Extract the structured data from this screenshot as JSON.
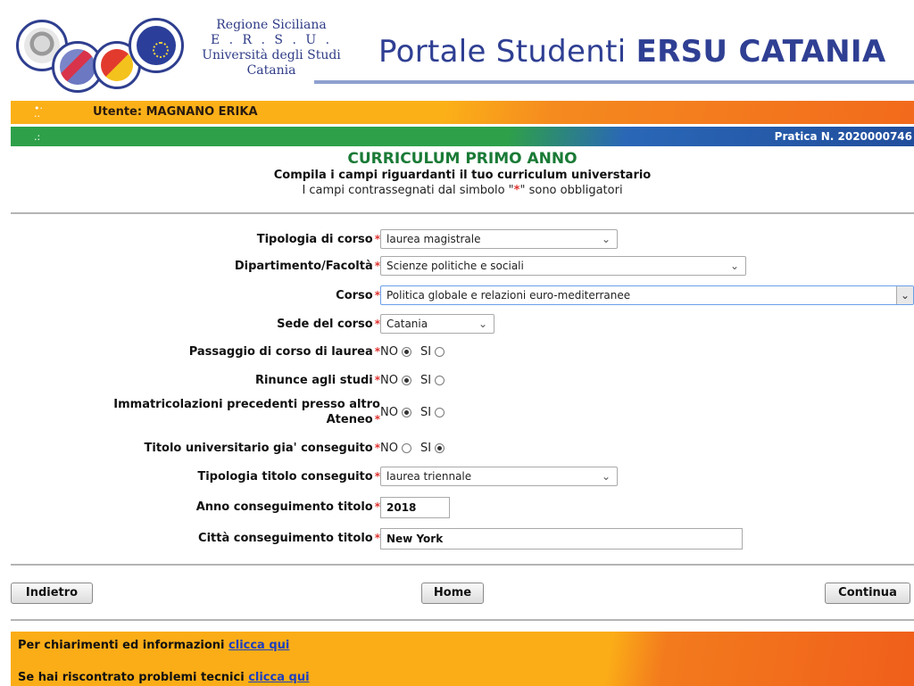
{
  "header": {
    "institution": [
      "Regione Siciliana",
      "E . R . S . U .",
      "Università degli Studi",
      "Catania"
    ],
    "portal_title_prefix": "Portale Studenti",
    "portal_title_bold": "ERSU CATANIA"
  },
  "userbar": {
    "user": "Utente: MAGNANO ERIKA"
  },
  "pracbar": {
    "pratica": "Pratica N. 2020000746"
  },
  "heading": {
    "title": "CURRICULUM PRIMO ANNO",
    "subtitle": "Compila i campi riguardanti il tuo curriculum universtario",
    "note_before": "I campi contrassegnati dal simbolo \"",
    "note_star": "*",
    "note_after": "\" sono obbligatori"
  },
  "form": {
    "required_mark": "*",
    "tipologia_corso": {
      "label": "Tipologia di corso",
      "value": "laurea magistrale"
    },
    "dipartimento": {
      "label": "Dipartimento/Facoltà",
      "value": "Scienze politiche e sociali"
    },
    "corso": {
      "label": "Corso",
      "value": "Politica globale e relazioni euro-mediterranee"
    },
    "sede": {
      "label": "Sede del corso",
      "value": "Catania"
    },
    "radio_no": "NO",
    "radio_si": "SI",
    "passaggio": {
      "label": "Passaggio di corso di laurea",
      "selected": "NO"
    },
    "rinunce": {
      "label": "Rinunce agli studi",
      "selected": "NO"
    },
    "immatricolazioni": {
      "label_line1": "Immatricolazioni precedenti presso altro",
      "label_line2": "Ateneo",
      "selected": "NO"
    },
    "titolo_conseguito": {
      "label": "Titolo universitario gia' conseguito",
      "selected": "SI"
    },
    "tipologia_titolo": {
      "label": "Tipologia titolo conseguito",
      "value": "laurea triennale"
    },
    "anno_titolo": {
      "label": "Anno conseguimento titolo",
      "value": "2018"
    },
    "citta_titolo": {
      "label": "Città conseguimento titolo",
      "value": "New York"
    }
  },
  "buttons": {
    "back": "Indietro",
    "home": "Home",
    "continue": "Continua"
  },
  "footer": {
    "info_text": "Per chiarimenti ed informazioni",
    "info_link": "clicca qui",
    "tech_text": "Se hai riscontrato problemi tecnici",
    "tech_link": "clicca qui"
  },
  "colors": {
    "orange": "#fbb018",
    "green": "#2ea04a",
    "blue": "#214e9c",
    "title_blue": "#2f3f93",
    "heading_green": "#1a7a36",
    "required_red": "#e0312c"
  }
}
